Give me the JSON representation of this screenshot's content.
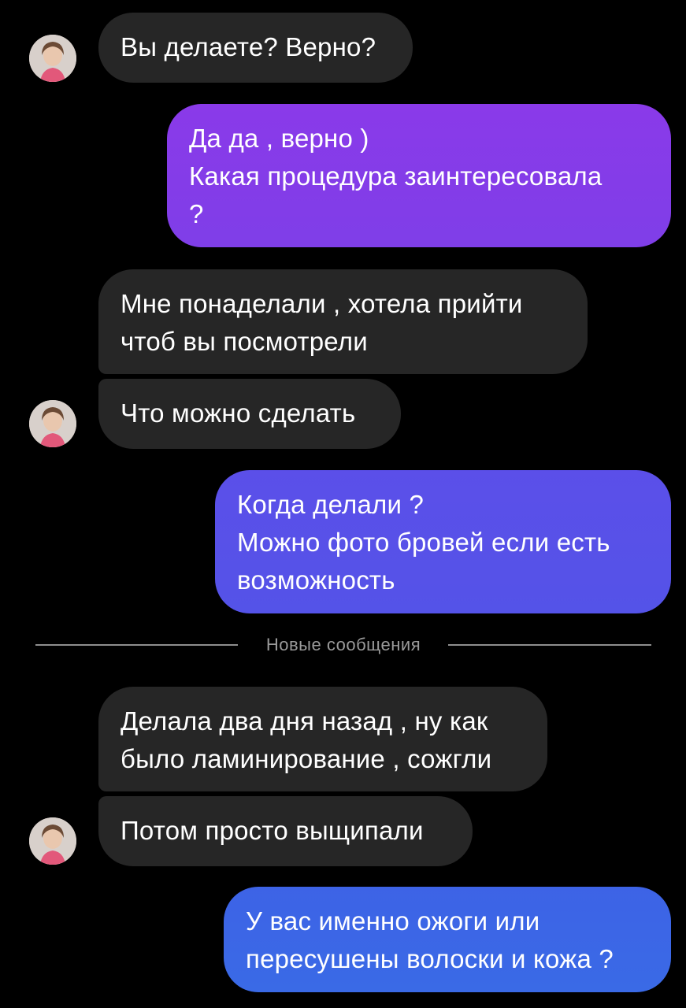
{
  "conversation": {
    "messages": [
      {
        "direction": "incoming",
        "lines": [
          "Вы делаете? Верно?"
        ]
      },
      {
        "direction": "outgoing",
        "lines": [
          "Да да , верно )",
          "Какая процедура заинтересовала",
          "?"
        ]
      },
      {
        "direction": "incoming",
        "lines": [
          "Мне понаделали , хотела прийти",
          "чтоб вы посмотрели"
        ]
      },
      {
        "direction": "incoming",
        "lines": [
          "Что можно сделать"
        ]
      },
      {
        "direction": "outgoing",
        "lines": [
          "Когда делали ?",
          "Можно фото бровей если есть",
          "возможность"
        ]
      },
      {
        "direction": "incoming",
        "lines": [
          "Делала два дня назад , ну как",
          "было ламинирование , сожгли"
        ]
      },
      {
        "direction": "incoming",
        "lines": [
          "Потом просто выщипали"
        ]
      },
      {
        "direction": "outgoing",
        "lines": [
          "У вас именно ожоги или",
          "пересушены волоски и кожа ?"
        ]
      }
    ],
    "new_messages_divider": "Новые сообщения"
  },
  "colors": {
    "background": "#000000",
    "incoming_bubble": "#262626",
    "outgoing_gradient_top": "#8a3ce8",
    "outgoing_gradient_bottom": "#3a6ae6",
    "divider_text": "#9a9a9a"
  },
  "icons": {
    "avatar": "contact-avatar-photo"
  }
}
